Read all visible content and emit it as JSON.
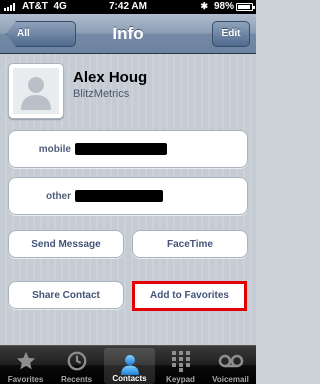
{
  "status_bar": {
    "carrier": "AT&T",
    "network": "4G",
    "time": "7:42 AM",
    "battery": "98%"
  },
  "nav": {
    "back_label": "All Contacts",
    "title": "Info",
    "edit_label": "Edit"
  },
  "contact": {
    "name": "Alex Houg",
    "company": "BlitzMetrics"
  },
  "phones": [
    {
      "label": "mobile"
    },
    {
      "label": "other"
    }
  ],
  "actions": {
    "send_message": "Send Message",
    "facetime": "FaceTime",
    "share_contact": "Share Contact",
    "add_to_favorites": "Add to Favorites"
  },
  "tabs": [
    {
      "label": "Favorites",
      "icon": "star-icon"
    },
    {
      "label": "Recents",
      "icon": "clock-icon"
    },
    {
      "label": "Contacts",
      "icon": "person-icon",
      "active": true
    },
    {
      "label": "Keypad",
      "icon": "keypad-icon"
    },
    {
      "label": "Voicemail",
      "icon": "voicemail-icon"
    }
  ],
  "colors": {
    "highlight": "#e40000",
    "nav_bar": "#7489a5",
    "action_text": "#435478"
  }
}
